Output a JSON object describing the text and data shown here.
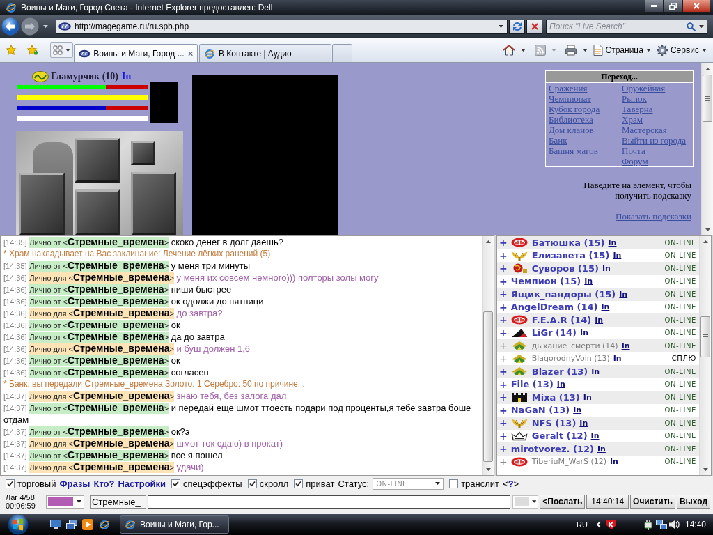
{
  "window": {
    "title": "Воины и Маги, Город Света - Internet Explorer предоставлен: Dell"
  },
  "address_bar": {
    "url": "http://magegame.ru/ru.spb.php"
  },
  "search": {
    "placeholder": "Поиск \"Live Search\""
  },
  "tabs": [
    {
      "label": "Воины и Маги, Город ...",
      "selected": true
    },
    {
      "label": "В Контакте | Аудио",
      "selected": false
    }
  ],
  "command_bar": {
    "menus": [
      "Страница",
      "Сервис"
    ]
  },
  "game": {
    "player": {
      "name": "Гламурчик (10)",
      "link": "In"
    },
    "bars": [
      {
        "color": "#00ff00",
        "level": 0.68
      },
      {
        "color": "#ffff00",
        "level": 1
      },
      {
        "color": "#0000cc",
        "level": 0.68
      },
      {
        "color": "#ffffff",
        "level": 1
      }
    ],
    "navigation": {
      "title": "Переход...",
      "columns": [
        [
          "Сражения",
          "Чемпионат",
          "Кубок города",
          "Библиотека",
          "Дом кланов",
          "Банк",
          "Башня магов"
        ],
        [
          "Оружейная",
          "Рынок",
          "Таверна",
          "Храм",
          "Мастерская",
          "Выйти из города",
          "Почта",
          "Форум"
        ]
      ]
    },
    "hint": "Наведите на элемент, чтобы получить подсказку",
    "hint_link": "Показать подсказки"
  },
  "chat": {
    "lines": [
      {
        "kind": "incoming",
        "time": "[14:35]",
        "tag": "Лично от <**Стремные_времена**>",
        "text": "скоко денег в долг даешь?"
      },
      {
        "kind": "system",
        "text": "* Храм накладывает на Вас заклинание: Лечение лёгких ранений (5)"
      },
      {
        "kind": "incoming",
        "time": "[14:35]",
        "tag": "Лично от <**Стремные_времена**>",
        "text": "у меня три минуты"
      },
      {
        "kind": "outgoing",
        "time": "[14:36]",
        "tag": "Лично для <**Стремные_времена**>",
        "text": "у меня их совсем немного))) полторы золы могу"
      },
      {
        "kind": "incoming",
        "time": "[14:36]",
        "tag": "Лично от <**Стремные_времена**>",
        "text": "пиши быстрее"
      },
      {
        "kind": "incoming",
        "time": "[14:36]",
        "tag": "Лично от <**Стремные_времена**>",
        "text": "ок одолжи до пятници"
      },
      {
        "kind": "outgoing",
        "time": "[14:36]",
        "tag": "Лично для <**Стремные_времена**>",
        "text": "до завтра?"
      },
      {
        "kind": "incoming",
        "time": "[14:36]",
        "tag": "Лично от <**Стремные_времена**>",
        "text": "ок"
      },
      {
        "kind": "incoming",
        "time": "[14:36]",
        "tag": "Лично от <**Стремные_времена**>",
        "text": "да до завтра"
      },
      {
        "kind": "outgoing",
        "time": "[14:36]",
        "tag": "Лично для <**Стремные_времена**>",
        "text": "и буш должен 1,6"
      },
      {
        "kind": "incoming",
        "time": "[14:36]",
        "tag": "Лично от <**Стремные_времена**>",
        "text": "ок"
      },
      {
        "kind": "incoming",
        "time": "[14:36]",
        "tag": "Лично от <**Стремные_времена**>",
        "text": "согласен"
      },
      {
        "kind": "system",
        "text": "* Банк: вы передали Стремные_времена Золото: 1 Серебро: 50 по причине: ."
      },
      {
        "kind": "outgoing",
        "time": "[14:37]",
        "tag": "Лично для <**Стремные_времена**>",
        "text": "знаю тебя, без залога дал"
      },
      {
        "kind": "incoming",
        "time": "[14:37]",
        "tag": "Лично от <**Стремные_времена**>",
        "text": "и передай еще шмот ттоесть подари под проценты,я тебе завтра боше отдам"
      },
      {
        "kind": "incoming",
        "time": "[14:37]",
        "tag": "Лично от <**Стремные_времена**>",
        "text": "ок?э"
      },
      {
        "kind": "outgoing",
        "time": "[14:37]",
        "tag": "Лично для <**Стремные_времена**>",
        "text": "шмот ток сдаю) в прокат)"
      },
      {
        "kind": "incoming",
        "time": "[14:37]",
        "tag": "Лично от <**Стремные_времена**>",
        "text": "все я пошел"
      },
      {
        "kind": "outgoing",
        "time": "[14:37]",
        "tag": "Лично для <**Стремные_времена**>",
        "text": "удачи)"
      }
    ]
  },
  "users": [
    {
      "kind": "oval",
      "expand": "+",
      "name": "Батюшка (15)",
      "link": "In",
      "status": "ON-LINE",
      "dimmed": false,
      "asleep": false
    },
    {
      "kind": "wings",
      "expand": "+",
      "name": "Елизавета (15)",
      "link": "In",
      "status": "ON-LINE",
      "dimmed": false,
      "asleep": false
    },
    {
      "kind": "swirl",
      "expand": "+",
      "name": "Суворов (15)",
      "link": "In",
      "status": "ON-LINE",
      "dimmed": false,
      "asleep": false
    },
    {
      "kind": "plain",
      "expand": "+",
      "name": "Чемпион (15)",
      "link": "In",
      "status": "ON-LINE",
      "dimmed": false,
      "asleep": false
    },
    {
      "kind": "plain",
      "expand": "+",
      "name": "Ящик_пандоры (15)",
      "link": "In",
      "status": "ON-LINE",
      "dimmed": false,
      "asleep": false
    },
    {
      "kind": "plain",
      "expand": "+",
      "name": "AngelDream (14)",
      "link": "In",
      "status": "ON-LINE",
      "dimmed": false,
      "asleep": false
    },
    {
      "kind": "oval",
      "expand": "+",
      "name": "F.E.A.R (14)",
      "link": "In",
      "status": "ON-LINE",
      "dimmed": false,
      "asleep": false
    },
    {
      "kind": "peak",
      "expand": "+",
      "name": "LiGr (14)",
      "link": "In",
      "status": "ON-LINE",
      "dimmed": false,
      "asleep": false
    },
    {
      "kind": "pagoda",
      "expand": "+",
      "name": "дыхание_смерти (14)",
      "link": "In",
      "status": "ON-LINE",
      "dimmed": true,
      "asleep": false
    },
    {
      "kind": "pagoda",
      "expand": "+",
      "name": "BlagorodnyVoin (13)",
      "link": "In",
      "status": "СПЛЮ",
      "dimmed": true,
      "asleep": true
    },
    {
      "kind": "pagoda",
      "expand": "+",
      "name": "Blazer (13)",
      "link": "In",
      "status": "ON-LINE",
      "dimmed": false,
      "asleep": false
    },
    {
      "kind": "plain",
      "expand": "+",
      "name": "File (13)",
      "link": "In",
      "status": "ON-LINE",
      "dimmed": false,
      "asleep": false
    },
    {
      "kind": "castle",
      "expand": "+",
      "name": "Mixa (13)",
      "link": "In",
      "status": "ON-LINE",
      "dimmed": false,
      "asleep": false
    },
    {
      "kind": "plain",
      "expand": "+",
      "name": "NaGaN (13)",
      "link": "In",
      "status": "ON-LINE",
      "dimmed": false,
      "asleep": false
    },
    {
      "kind": "wings",
      "expand": "+",
      "name": "NFS (13)",
      "link": "In",
      "status": "ON-LINE",
      "dimmed": false,
      "asleep": false
    },
    {
      "kind": "crown",
      "expand": "+",
      "name": "Geralt (12)",
      "link": "In",
      "status": "ON-LINE",
      "dimmed": false,
      "asleep": false
    },
    {
      "kind": "plain",
      "expand": "+",
      "name": "mirotvorez. (12)",
      "link": "In",
      "status": "ON-LINE",
      "dimmed": false,
      "asleep": false
    },
    {
      "kind": "oval",
      "expand": "+",
      "name": "TiberiuM_WarS (12)",
      "link": "In",
      "status": "ON-LINE",
      "dimmed": true,
      "asleep": false
    }
  ],
  "controls": [
    {
      "kind": "checkbox",
      "label": "торговый",
      "checked": true
    },
    {
      "kind": "link",
      "label": "Фразы"
    },
    {
      "kind": "link",
      "label": "Кто?"
    },
    {
      "kind": "link",
      "label": "Настройки"
    },
    {
      "kind": "checkbox",
      "label": "спецэффекты",
      "checked": true
    },
    {
      "kind": "checkbox",
      "label": "скролл",
      "checked": true
    },
    {
      "kind": "checkbox",
      "label": "приват",
      "checked": true
    },
    {
      "kind": "select",
      "label": "Статус:",
      "value": "ON-LINE"
    },
    {
      "kind": "checkbox",
      "label": "транслит",
      "checked": false
    },
    {
      "kind": "help",
      "before": "<",
      "label": "?",
      "after": ">"
    }
  ],
  "input_row": {
    "lag": "Лаг 4/58",
    "timer": "00:06:59",
    "color_picker": {
      "color": "#b35cb3"
    },
    "prefix": "Стремные_",
    "buttons": [
      {
        "kind": "button",
        "label": "<Послать"
      },
      {
        "kind": "clock",
        "label": "14:40:14"
      },
      {
        "kind": "button",
        "label": "Очистить"
      },
      {
        "kind": "button",
        "label": "Выход"
      }
    ]
  },
  "taskbar": {
    "task": "Воины и Маги, Гор...",
    "language": "RU",
    "clock": "14:40"
  }
}
